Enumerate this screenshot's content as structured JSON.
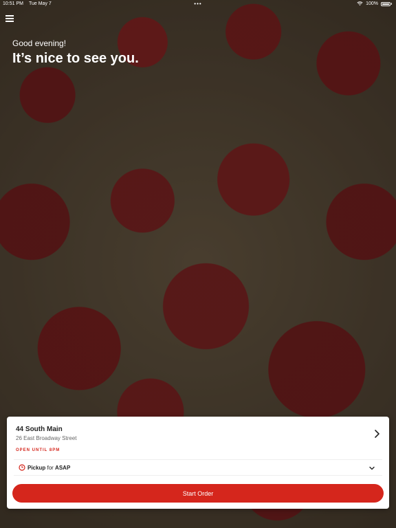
{
  "status_bar": {
    "time": "10:51 PM",
    "date": "Tue May 7",
    "center_dots": "•••",
    "battery": "100%"
  },
  "header": {
    "greeting": "Good evening!",
    "headline": "It’s nice to see you."
  },
  "store": {
    "name": "44 South Main",
    "address": "26 East Broadway Street",
    "hours": "OPEN UNTIL 8PM"
  },
  "order": {
    "mode": "Pickup",
    "for_word": "for",
    "time": "ASAP"
  },
  "cta": {
    "label": "Start Order"
  },
  "colors": {
    "accent": "#d5261c"
  },
  "icons": [
    "menu-icon",
    "wifi-icon",
    "battery-icon",
    "chevron-right-icon",
    "clock-icon",
    "chevron-down-icon"
  ]
}
